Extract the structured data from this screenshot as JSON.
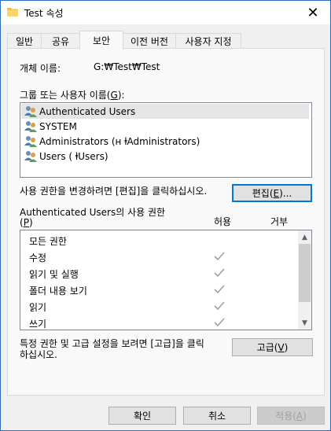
{
  "window": {
    "title": "Test 속성",
    "close_glyph": "✕"
  },
  "tabs": [
    {
      "label": "일반"
    },
    {
      "label": "공유"
    },
    {
      "label": "보안"
    },
    {
      "label": "이전 버전"
    },
    {
      "label": "사용자 지정"
    }
  ],
  "active_tab": "보안",
  "object": {
    "label": "개체 이름:",
    "value": "G:₩Test₩Test"
  },
  "groups": {
    "label": "그룹 또는 사용자 이름(",
    "label_key": "G",
    "label_end": "):",
    "items": [
      {
        "name": "Authenticated Users",
        "selected": true
      },
      {
        "name": "SYSTEM",
        "selected": false
      },
      {
        "name": "Administrators (ʜ      ⱡAdministrators)",
        "selected": false
      },
      {
        "name": "Users (       ⱡUsers)",
        "selected": false
      }
    ]
  },
  "edit_hint": "사용 권한을 변경하려면 [편집]을 클릭하십시오.",
  "edit_button": {
    "label": "편집(",
    "key": "E",
    "end": ")..."
  },
  "permissions": {
    "title": "Authenticated Users의 사용 권한",
    "title_key": "P",
    "allow_header": "허용",
    "deny_header": "거부",
    "rows": [
      {
        "name": "모든 권한",
        "allow": false,
        "deny": false
      },
      {
        "name": "수정",
        "allow": true,
        "deny": false
      },
      {
        "name": "읽기 및 실행",
        "allow": true,
        "deny": false
      },
      {
        "name": "폴더 내용 보기",
        "allow": true,
        "deny": false
      },
      {
        "name": "읽기",
        "allow": true,
        "deny": false
      },
      {
        "name": "쓰기",
        "allow": true,
        "deny": false
      }
    ]
  },
  "advanced_hint_line1": "특정 권한 및 고급 설정을 보려면 [고급]을 클릭",
  "advanced_hint_line2": "하십시오.",
  "advanced_button": {
    "label": "고급(",
    "key": "V",
    "end": ")"
  },
  "footer": {
    "ok": "확인",
    "cancel": "취소",
    "apply": "적용(",
    "apply_key": "A",
    "apply_end": ")"
  },
  "colors": {
    "accent": "#0078d7",
    "selection": "#e5e5e5",
    "check": "#a0a0a0"
  }
}
